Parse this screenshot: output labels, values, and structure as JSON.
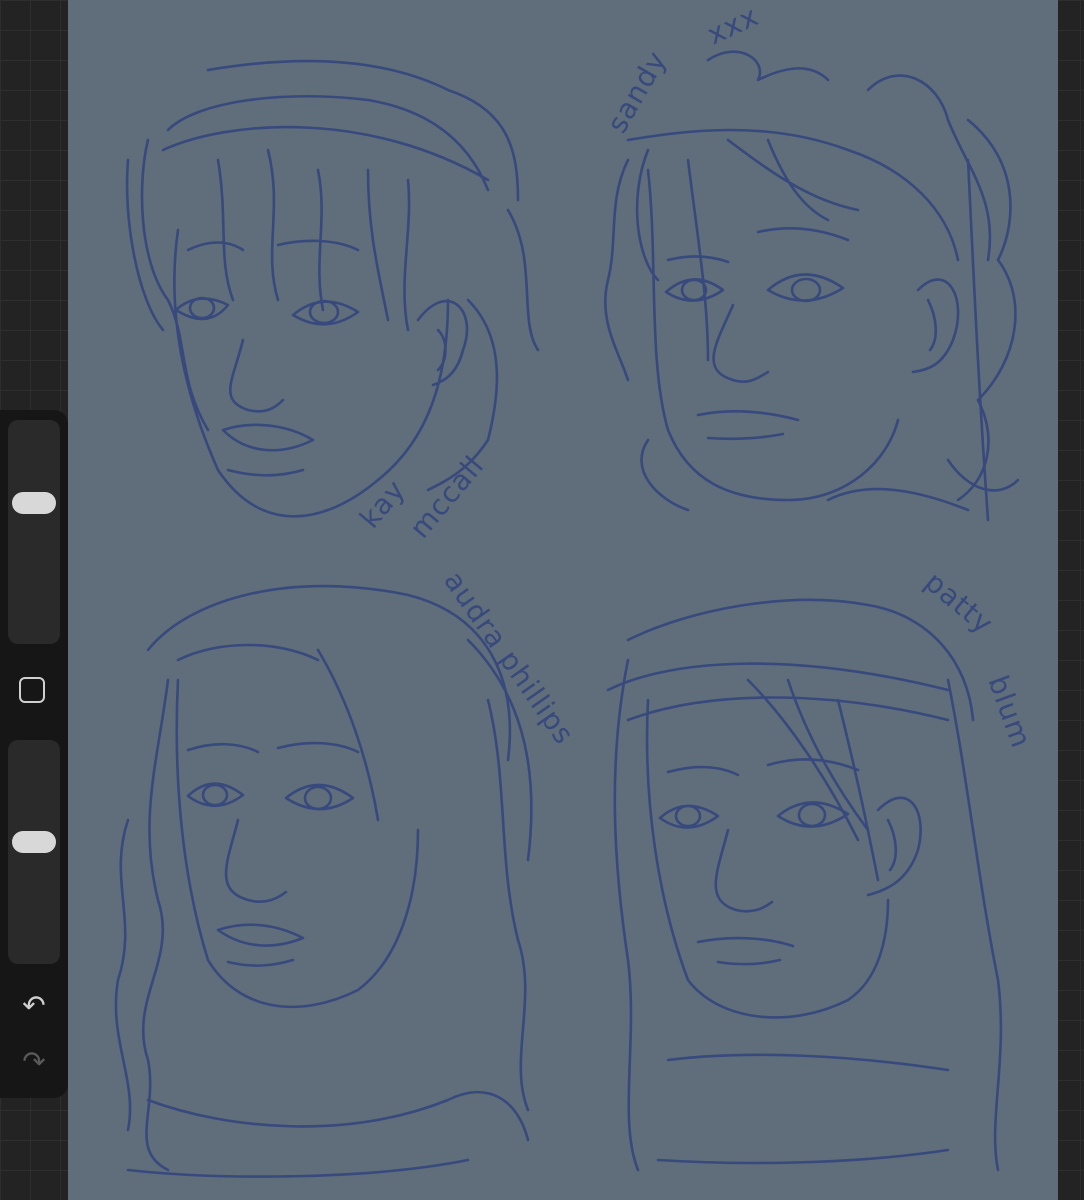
{
  "canvas": {
    "background": "#5f6e7a",
    "ink": "#38497d",
    "labels": {
      "portrait1_line1": "kay",
      "portrait1_line2": "mccall",
      "portrait2_name": "sandy",
      "portrait2_extra": "xxx",
      "portrait3_name": "audra phillips",
      "portrait4_line1": "patty",
      "portrait4_line2": "blum"
    }
  },
  "sidebar": {
    "brush_size_slider": {
      "level": 0.65
    },
    "opacity_slider": {
      "level": 0.55
    },
    "icons": {
      "modifier": "square-icon",
      "undo": "undo-icon",
      "redo": "redo-icon"
    }
  }
}
